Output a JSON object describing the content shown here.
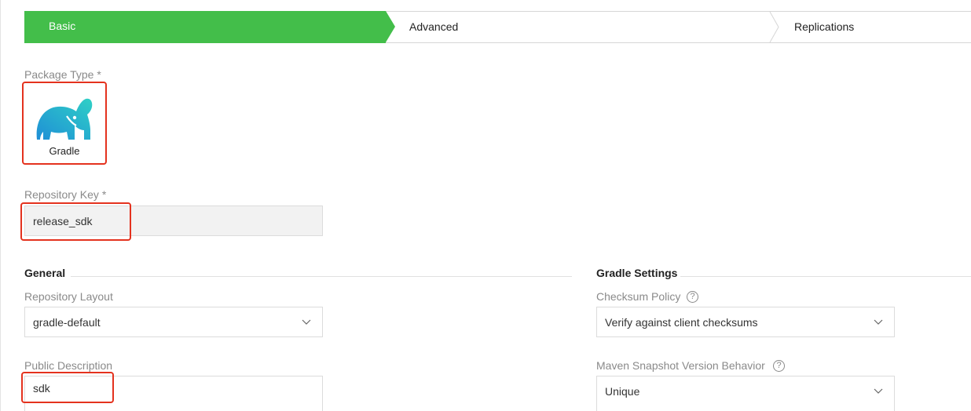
{
  "steps": [
    {
      "label": "Basic",
      "active": true
    },
    {
      "label": "Advanced",
      "active": false
    },
    {
      "label": "Replications",
      "active": false
    }
  ],
  "package": {
    "label": "Package Type *",
    "selected": "Gradle",
    "icon": "gradle-elephant-icon"
  },
  "repo_key": {
    "label": "Repository Key *",
    "value": "release_sdk"
  },
  "general": {
    "title": "General",
    "layout_label": "Repository Layout",
    "layout_value": "gradle-default",
    "description_label": "Public Description",
    "description_value": "sdk"
  },
  "gradle_settings": {
    "title": "Gradle Settings",
    "checksum_label": "Checksum Policy",
    "checksum_value": "Verify against client checksums",
    "snapshot_label": "Maven Snapshot Version Behavior",
    "snapshot_value": "Unique",
    "help_glyph": "?"
  },
  "colors": {
    "active_step": "#43be4a",
    "highlight": "#e4321e",
    "gradle_icon": "#2db3c9"
  }
}
